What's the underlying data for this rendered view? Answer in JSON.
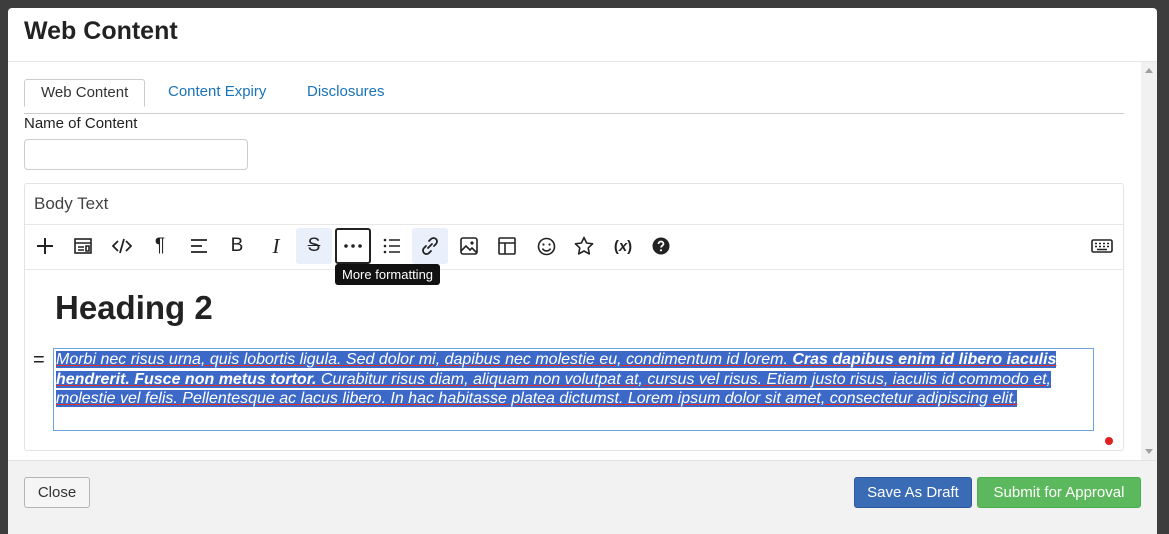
{
  "modal": {
    "title": "Web Content"
  },
  "tabs": [
    {
      "label": "Web Content",
      "active": true
    },
    {
      "label": "Content Expiry",
      "active": false
    },
    {
      "label": "Disclosures",
      "active": false
    }
  ],
  "form": {
    "name_label": "Name of Content",
    "name_value": ""
  },
  "editor": {
    "label": "Body Text",
    "toolbar": [
      {
        "name": "insert",
        "icon": "plus-icon"
      },
      {
        "name": "templates",
        "icon": "template-icon"
      },
      {
        "name": "source-code",
        "icon": "code-icon"
      },
      {
        "name": "paragraph-format",
        "icon": "pilcrow-icon"
      },
      {
        "name": "align",
        "icon": "align-left-icon"
      },
      {
        "name": "bold",
        "icon": "bold-icon"
      },
      {
        "name": "italic",
        "icon": "italic-icon"
      },
      {
        "name": "strikethrough",
        "icon": "strikethrough-icon",
        "active": true
      },
      {
        "name": "more-formatting",
        "icon": "ellipsis-icon",
        "focused": true
      },
      {
        "name": "bulleted-list",
        "icon": "list-icon"
      },
      {
        "name": "link",
        "icon": "link-icon",
        "active": true
      },
      {
        "name": "image",
        "icon": "image-icon"
      },
      {
        "name": "table",
        "icon": "table-icon"
      },
      {
        "name": "emoji",
        "icon": "smiley-icon"
      },
      {
        "name": "favorite",
        "icon": "star-icon"
      },
      {
        "name": "variables",
        "icon": "variable-icon"
      },
      {
        "name": "help",
        "icon": "help-icon"
      },
      {
        "name": "keyboard-shortcuts",
        "icon": "keyboard-icon"
      }
    ],
    "tooltip": "More formatting",
    "heading": "Heading 2",
    "drag_handle": "=",
    "paragraph": {
      "part1": "Morbi nec risus urna, quis lobortis ligula. Sed dolor mi, dapibus nec molestie eu, condimentum id lorem. ",
      "part2_bold": "Cras dapibus enim id libero iaculis hendrerit. Fusce non metus tortor.",
      "part3": " Curabitur risus diam, aliquam non volutpat at, cursus vel risus. Etiam justo risus, iaculis id commodo et, molestie vel felis. Pellentesque ac lacus libero. In hac habitasse platea dictumst. Lorem ipsum dolor sit amet, consectetur adipiscing elit."
    }
  },
  "footer": {
    "close": "Close",
    "save_draft": "Save As Draft",
    "submit": "Submit for Approval"
  },
  "colors": {
    "primary": "#3a6bb5",
    "success": "#5cb85c",
    "selection": "#3c68c8",
    "link": "#1a73b8"
  }
}
